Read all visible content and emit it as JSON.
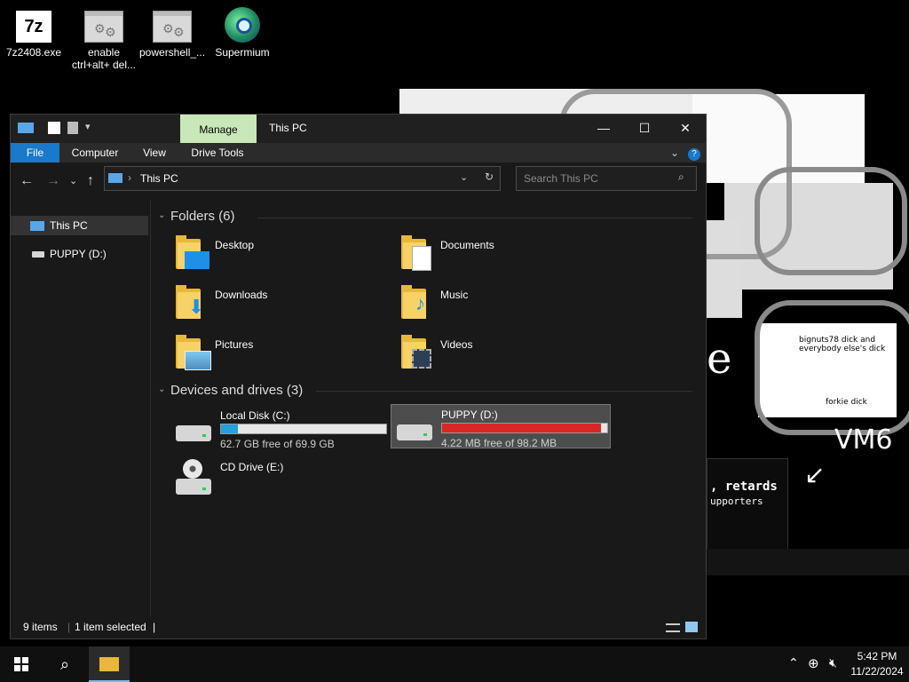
{
  "desktop": {
    "icons": [
      {
        "label": "7z2408.exe",
        "icon": "7z-archive-icon",
        "glyph": "7z"
      },
      {
        "label": "enable ctrl+alt+ del...",
        "icon": "script-file-icon"
      },
      {
        "label": "powershell_...",
        "icon": "script-file-icon"
      },
      {
        "label": "Supermium",
        "icon": "browser-globe-icon"
      }
    ],
    "background_text": {
      "vm_label": "VM6",
      "banner": ", retards",
      "supporters": "upporters",
      "caption1": "bignuts78 dick and everybody else's dick",
      "caption2": "forkie dick"
    }
  },
  "explorer": {
    "title": "This PC",
    "manage_tab": "Manage",
    "ribbon_tabs": [
      "File",
      "Computer",
      "View",
      "Drive Tools"
    ],
    "address": "This PC",
    "search_placeholder": "Search This PC",
    "nav": [
      {
        "label": "This PC",
        "icon": "computer-icon",
        "selected": true
      },
      {
        "label": "PUPPY (D:)",
        "icon": "drive-icon",
        "selected": false
      }
    ],
    "folders_header": "Folders (6)",
    "folders": [
      {
        "name": "Desktop",
        "icon": "desktop-folder-icon"
      },
      {
        "name": "Documents",
        "icon": "documents-folder-icon"
      },
      {
        "name": "Downloads",
        "icon": "downloads-folder-icon"
      },
      {
        "name": "Music",
        "icon": "music-folder-icon"
      },
      {
        "name": "Pictures",
        "icon": "pictures-folder-icon"
      },
      {
        "name": "Videos",
        "icon": "videos-folder-icon"
      }
    ],
    "drives_header": "Devices and drives (3)",
    "drives": [
      {
        "name": "Local Disk (C:)",
        "free_text": "62.7 GB free of 69.9 GB",
        "used_fraction": 0.1,
        "bar_color": "#26a0da",
        "selected": false,
        "icon": "hard-disk-icon"
      },
      {
        "name": "PUPPY (D:)",
        "free_text": "4.22 MB free of 98.2 MB",
        "used_fraction": 0.96,
        "bar_color": "#da2626",
        "selected": true,
        "icon": "hard-disk-icon"
      },
      {
        "name": "CD Drive (E:)",
        "free_text": "",
        "used_fraction": null,
        "bar_color": "",
        "selected": false,
        "icon": "cd-drive-icon"
      }
    ],
    "status": {
      "items": "9 items",
      "selected": "1 item selected"
    }
  },
  "taskbar": {
    "time": "5:42 PM",
    "date": "11/22/2024"
  },
  "colors": {
    "accent": "#1979ca",
    "manage_tab": "#c9e8b9",
    "folder": "#f7d266"
  }
}
